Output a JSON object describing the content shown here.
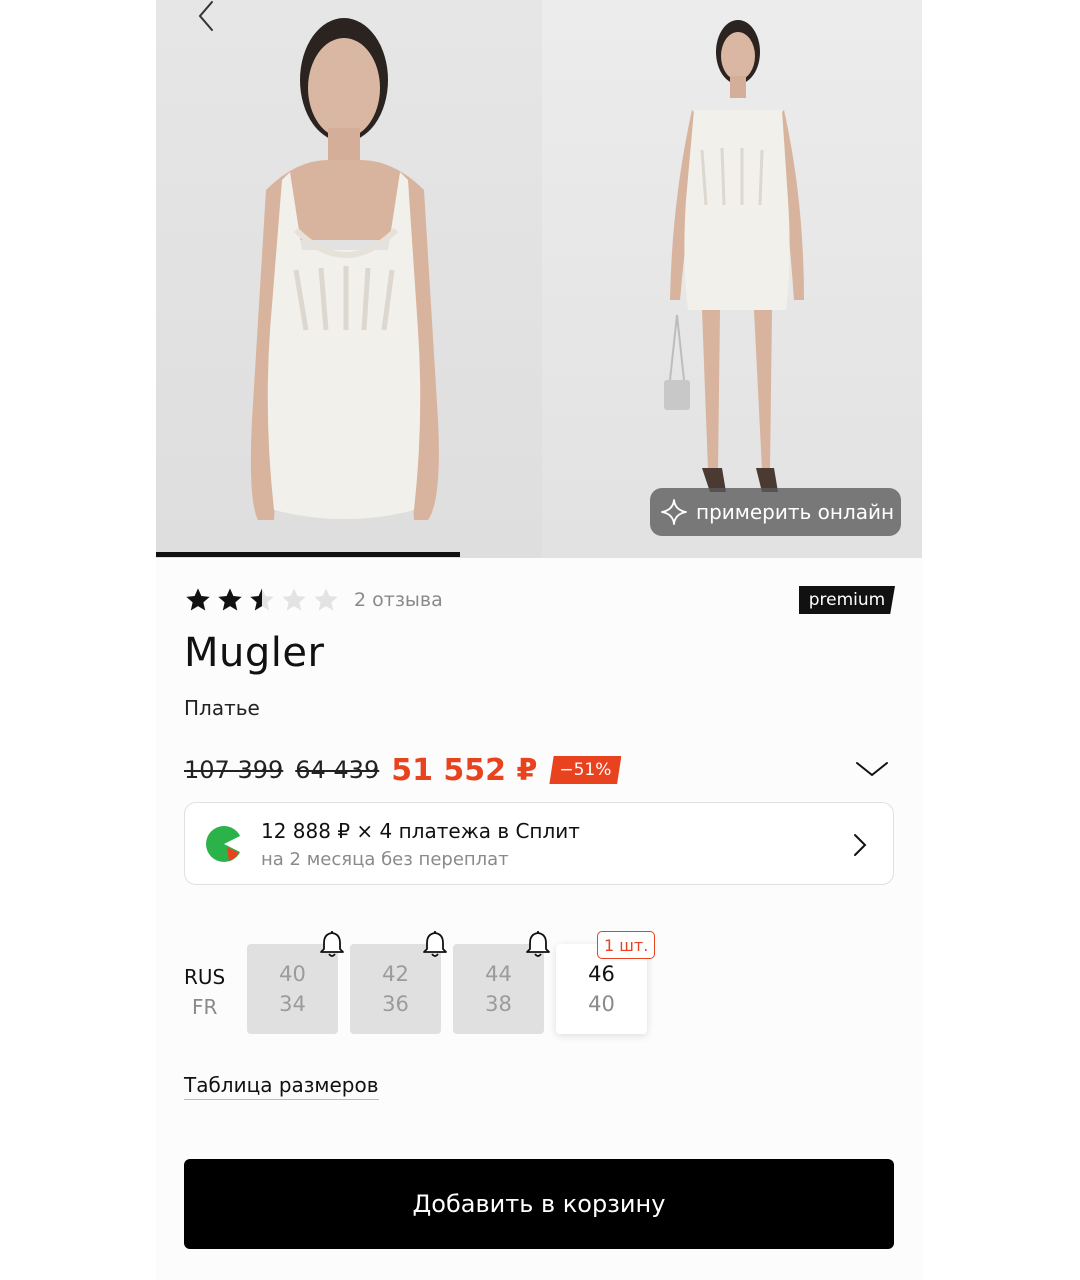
{
  "gallery": {
    "photos": [
      {
        "alt_name": "product-photo-front-closeup"
      },
      {
        "alt_name": "product-photo-full-length"
      }
    ],
    "tryon_label": "примерить онлайн",
    "progress_fraction": 0.4
  },
  "rating": {
    "value": 2.5,
    "max": 5,
    "reviews_label": "2 отзыва"
  },
  "premium_badge": "premium",
  "product": {
    "brand": "Mugler",
    "category": "Платье"
  },
  "price": {
    "original": "107 399",
    "previous": "64 439",
    "current": "51 552 ₽",
    "discount": "−51%"
  },
  "split": {
    "line1": "12 888 ₽ × 4 платежа в Сплит",
    "line2": "на 2 месяца без переплат"
  },
  "sizes": {
    "system_primary": "RUS",
    "system_secondary": "FR",
    "items": [
      {
        "rus": "40",
        "fr": "34",
        "available": false
      },
      {
        "rus": "42",
        "fr": "36",
        "available": false
      },
      {
        "rus": "44",
        "fr": "38",
        "available": false
      },
      {
        "rus": "46",
        "fr": "40",
        "available": true
      }
    ],
    "stock_badge": "1 шт."
  },
  "size_table_link": "Таблица размеров",
  "add_to_cart_label": "Добавить в корзину",
  "colors": {
    "accent": "#e8421f",
    "primary": "#000000",
    "split_green": "#2bb34a"
  }
}
